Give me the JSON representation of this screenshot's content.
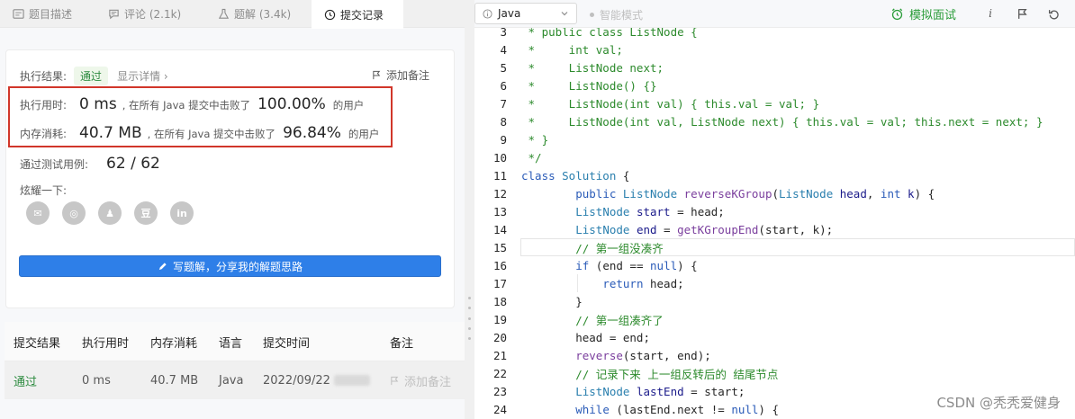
{
  "tabs": [
    {
      "label": "题目描述",
      "icon": "description-icon"
    },
    {
      "label": "评论 (2.1k)",
      "icon": "comment-icon"
    },
    {
      "label": "题解 (3.4k)",
      "icon": "flask-icon"
    },
    {
      "label": "提交记录",
      "icon": "clock-icon"
    }
  ],
  "result": {
    "label": "执行结果:",
    "status": "通过",
    "details_link": "显示详情 ›",
    "add_note": "添加备注"
  },
  "stats": {
    "runtime_label": "执行用时:",
    "runtime_value": "0 ms",
    "runtime_mid": ", 在所有 Java 提交中击败了",
    "runtime_pct": "100.00%",
    "runtime_suffix": "的用户",
    "memory_label": "内存消耗:",
    "memory_value": "40.7 MB",
    "memory_mid": ", 在所有 Java 提交中击败了",
    "memory_pct": "96.84%",
    "memory_suffix": "的用户",
    "cases_label": "通过测试用例:",
    "cases_value": "62 / 62"
  },
  "share": {
    "label": "炫耀一下:",
    "icons": [
      {
        "name": "wechat-icon",
        "glyph": "✉"
      },
      {
        "name": "weibo-icon",
        "glyph": "◎"
      },
      {
        "name": "qq-icon",
        "glyph": "♟"
      },
      {
        "name": "douban-icon",
        "glyph": "豆"
      },
      {
        "name": "linkedin-icon",
        "glyph": "in"
      }
    ]
  },
  "write_button": "写题解，分享我的解题思路",
  "table": {
    "headers": [
      "提交结果",
      "执行用时",
      "内存消耗",
      "语言",
      "提交时间",
      "备注"
    ],
    "rows": [
      {
        "status": "通过",
        "runtime": "0 ms",
        "memory": "40.7 MB",
        "lang": "Java",
        "time": "2022/09/22",
        "note": "添加备注"
      }
    ]
  },
  "toolbar": {
    "language": "Java",
    "smart_mode": "智能模式",
    "mock_interview": "模拟面试",
    "info_glyph": "i"
  },
  "editor": {
    "lines": [
      {
        "n": "3",
        "tokens": [
          [
            "cm",
            " * public class ListNode {"
          ]
        ]
      },
      {
        "n": "4",
        "tokens": [
          [
            "cm",
            " *     int val;"
          ]
        ]
      },
      {
        "n": "5",
        "tokens": [
          [
            "cm",
            " *     ListNode next;"
          ]
        ]
      },
      {
        "n": "6",
        "tokens": [
          [
            "cm",
            " *     ListNode() {}"
          ]
        ]
      },
      {
        "n": "7",
        "tokens": [
          [
            "cm",
            " *     ListNode(int val) { this.val = val; }"
          ]
        ]
      },
      {
        "n": "8",
        "tokens": [
          [
            "cm",
            " *     ListNode(int val, ListNode next) { this.val = val; this.next = next; }"
          ]
        ]
      },
      {
        "n": "9",
        "tokens": [
          [
            "cm",
            " * }"
          ]
        ]
      },
      {
        "n": "10",
        "tokens": [
          [
            "cm",
            " */"
          ]
        ]
      },
      {
        "n": "11",
        "tokens": [
          [
            "kw",
            "class "
          ],
          [
            "ty",
            "Solution"
          ],
          [
            "pl",
            " {"
          ]
        ]
      },
      {
        "n": "12",
        "tokens": [
          [
            "pl",
            "        "
          ],
          [
            "kw",
            "public "
          ],
          [
            "ty",
            "ListNode "
          ],
          [
            "fn",
            "reverseKGroup"
          ],
          [
            "pl",
            "("
          ],
          [
            "ty",
            "ListNode "
          ],
          [
            "vr",
            "head"
          ],
          [
            "pl",
            ", "
          ],
          [
            "kw",
            "int "
          ],
          [
            "vr",
            "k"
          ],
          [
            "pl",
            ") {"
          ]
        ]
      },
      {
        "n": "13",
        "tokens": [
          [
            "pl",
            "        "
          ],
          [
            "ty",
            "ListNode "
          ],
          [
            "vr",
            "start"
          ],
          [
            "pl",
            " = head;"
          ]
        ]
      },
      {
        "n": "14",
        "tokens": [
          [
            "pl",
            "        "
          ],
          [
            "ty",
            "ListNode "
          ],
          [
            "vr",
            "end"
          ],
          [
            "pl",
            " = "
          ],
          [
            "fn",
            "getKGroupEnd"
          ],
          [
            "pl",
            "(start, k);"
          ]
        ]
      },
      {
        "n": "15",
        "tokens": [
          [
            "pl",
            "        "
          ],
          [
            "cm",
            "// 第一组没凑齐"
          ]
        ],
        "current": true
      },
      {
        "n": "16",
        "tokens": [
          [
            "pl",
            "        "
          ],
          [
            "kw",
            "if "
          ],
          [
            "pl",
            "(end == "
          ],
          [
            "nl",
            "null"
          ],
          [
            "pl",
            ") {"
          ]
        ]
      },
      {
        "n": "17",
        "tokens": [
          [
            "pl",
            "            "
          ],
          [
            "kw",
            "return "
          ],
          [
            "pl",
            "head;"
          ]
        ]
      },
      {
        "n": "18",
        "tokens": [
          [
            "pl",
            "        }"
          ]
        ]
      },
      {
        "n": "19",
        "tokens": [
          [
            "pl",
            "        "
          ],
          [
            "cm",
            "// 第一组凑齐了"
          ]
        ]
      },
      {
        "n": "20",
        "tokens": [
          [
            "pl",
            "        head = end;"
          ]
        ]
      },
      {
        "n": "21",
        "tokens": [
          [
            "pl",
            "        "
          ],
          [
            "fn",
            "reverse"
          ],
          [
            "pl",
            "(start, end);"
          ]
        ]
      },
      {
        "n": "22",
        "tokens": [
          [
            "pl",
            "        "
          ],
          [
            "cm",
            "// 记录下来 上一组反转后的 结尾节点"
          ]
        ]
      },
      {
        "n": "23",
        "tokens": [
          [
            "pl",
            "        "
          ],
          [
            "ty",
            "ListNode "
          ],
          [
            "vr",
            "lastEnd"
          ],
          [
            "pl",
            " = start;"
          ]
        ]
      },
      {
        "n": "24",
        "tokens": [
          [
            "pl",
            "        "
          ],
          [
            "kw",
            "while "
          ],
          [
            "pl",
            "(lastEnd.next != "
          ],
          [
            "nl",
            "null"
          ],
          [
            "pl",
            ") {"
          ]
        ]
      }
    ]
  },
  "watermark": "CSDN @秃秃爱健身",
  "colors": {
    "accent": "#2e7fe8",
    "success": "#2b8a3e",
    "highlight_border": "#d1362a"
  }
}
